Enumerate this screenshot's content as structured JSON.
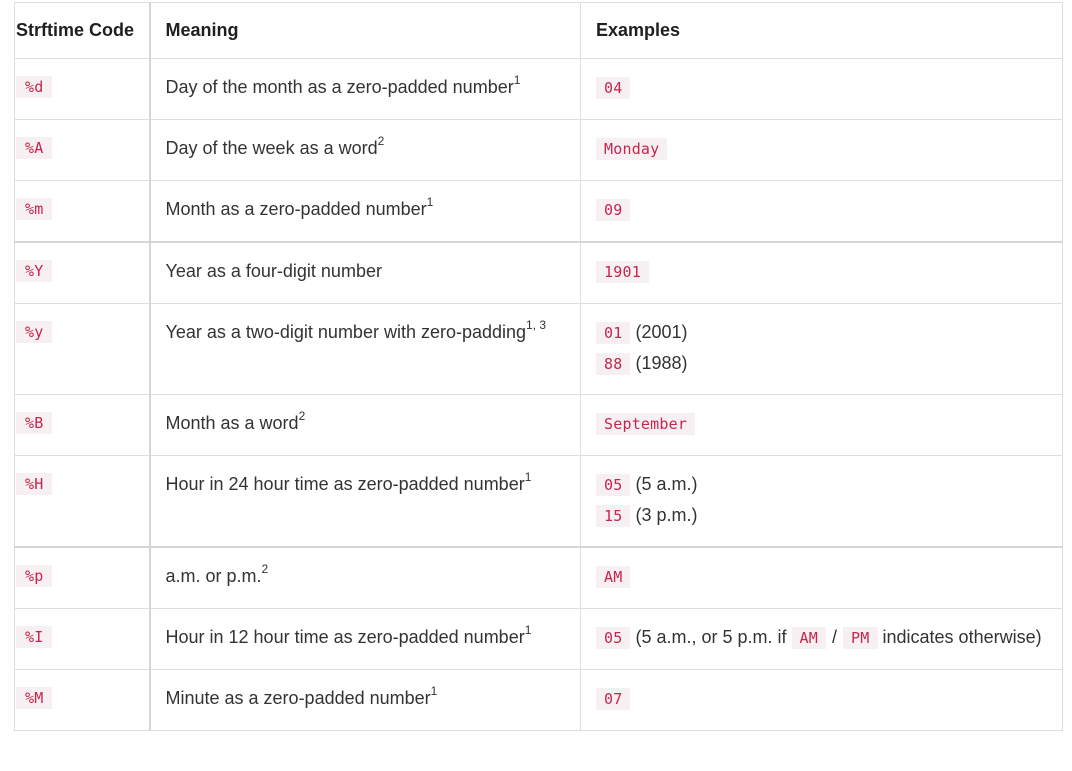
{
  "headers": {
    "code": "Strftime Code",
    "meaning": "Meaning",
    "examples": "Examples"
  },
  "rows": [
    {
      "code": "%d",
      "meaning": "Day of the month as a zero-padded number",
      "sup": "1",
      "ex1": "04"
    },
    {
      "code": "%A",
      "meaning": "Day of the week as a word",
      "sup": "2",
      "ex1": "Monday"
    },
    {
      "code": "%m",
      "meaning": "Month as a zero-padded number",
      "sup": "1",
      "ex1": "09"
    },
    {
      "code": "%Y",
      "meaning": "Year as a four-digit number",
      "sup": "",
      "ex1": "1901"
    },
    {
      "code": "%y",
      "meaning": "Year as a two-digit number with zero-padding",
      "sup": "1, 3",
      "ex1": "01",
      "ex1_note": "(2001)",
      "ex2": "88",
      "ex2_note": "(1988)"
    },
    {
      "code": "%B",
      "meaning": "Month as a word",
      "sup": "2",
      "ex1": "September"
    },
    {
      "code": "%H",
      "meaning": "Hour in 24 hour time as zero-padded number",
      "sup": "1",
      "ex1": "05",
      "ex1_note": "(5 a.m.)",
      "ex2": "15",
      "ex2_note": "(3 p.m.)"
    },
    {
      "code": "%p",
      "meaning": "a.m. or p.m.",
      "sup": "2",
      "ex1": "AM"
    },
    {
      "code": "%I",
      "meaning": "Hour in 12 hour time as zero-padded number",
      "sup": "1",
      "ex1": "05",
      "ex1_note_a": "(5 a.m., or 5 p.m. if",
      "ex1_code_a": "AM",
      "ex1_slash": "/",
      "ex1_code_b": "PM",
      "ex1_note_b": "indicates otherwise)"
    },
    {
      "code": "%M",
      "meaning": "Minute as a zero-padded number",
      "sup": "1",
      "ex1": "07"
    }
  ]
}
